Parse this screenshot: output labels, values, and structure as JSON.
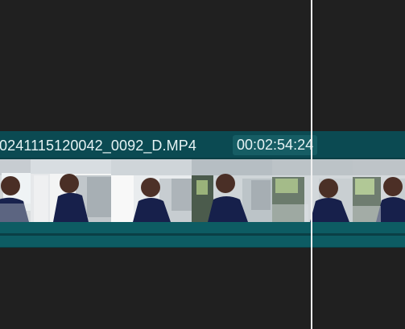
{
  "timeline": {
    "clip": {
      "filename": "0241115120042_0092_D.MP4",
      "duration": "00:02:54:24"
    },
    "thumbnail_count": 6
  },
  "colors": {
    "background": "#202020",
    "track": "#0a3f45",
    "clip_header": "#0b4a52",
    "duration_badge": "#165d64",
    "audio_band": "#0d5c63",
    "playhead": "#f1f1f1"
  },
  "icons": {
    "playhead": "playhead-line-icon"
  }
}
